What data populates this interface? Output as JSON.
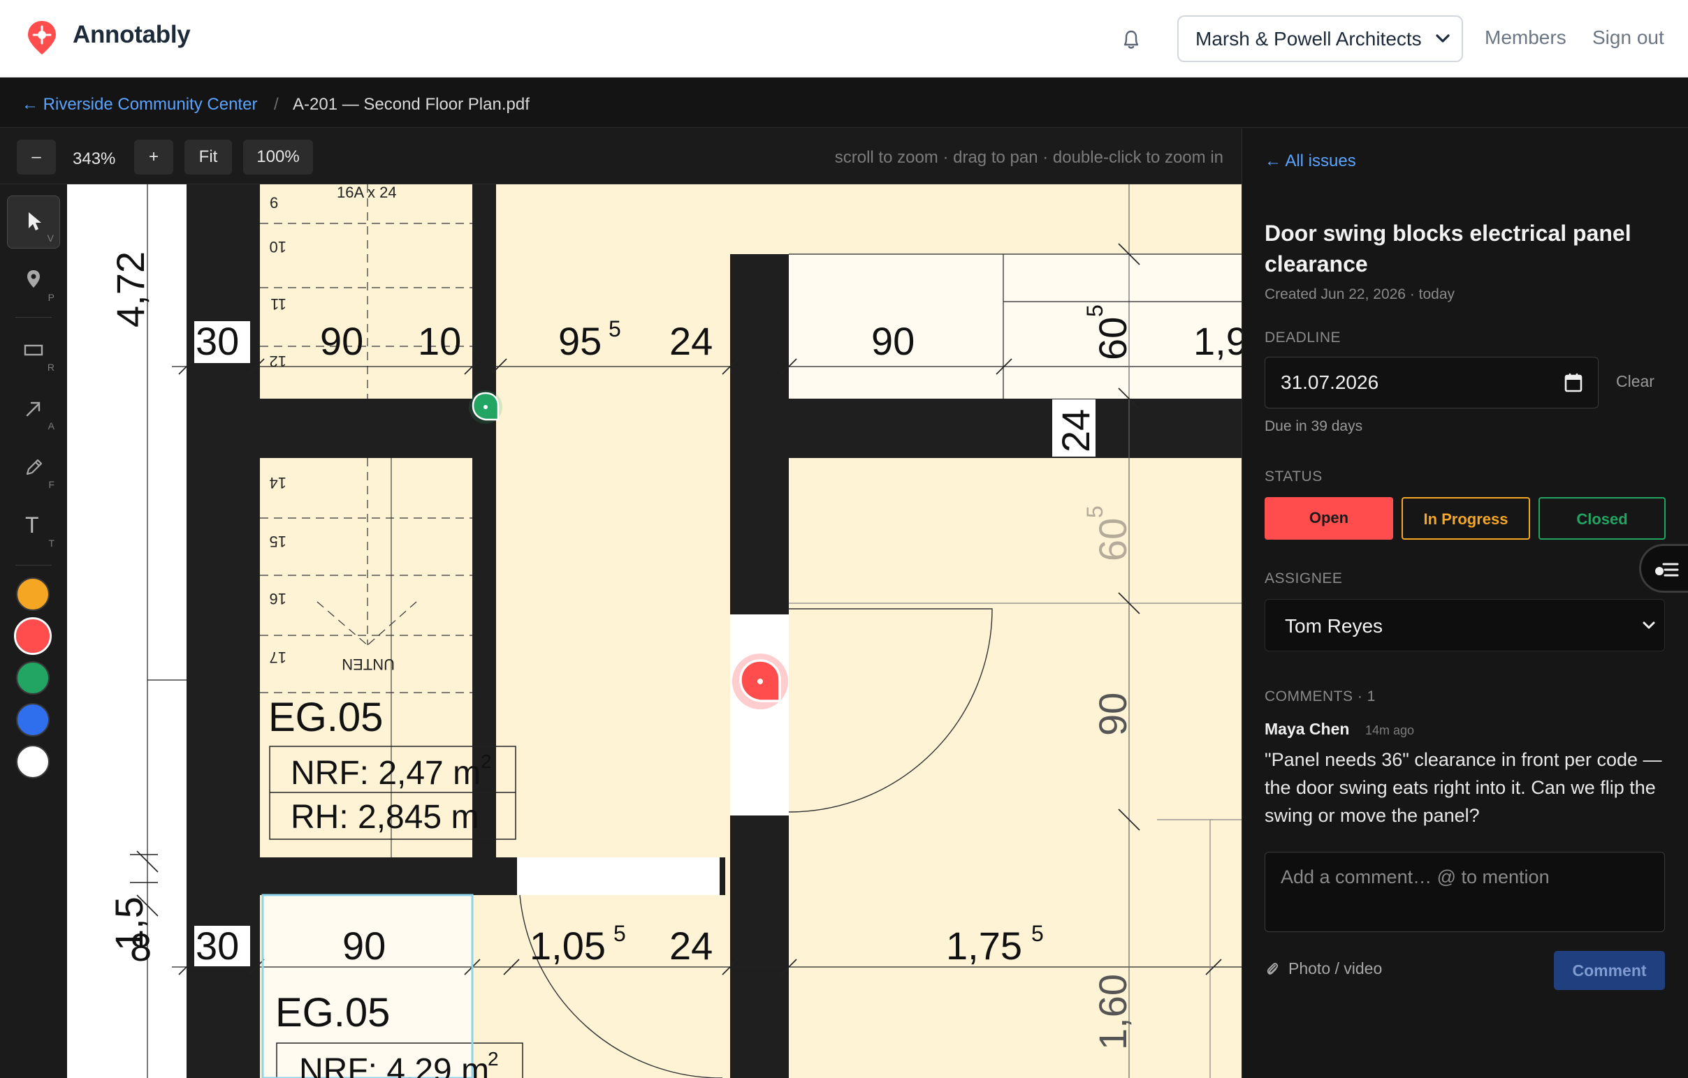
{
  "app": {
    "name": "Annotably",
    "brand_color": "#ff4d4d"
  },
  "header": {
    "org": "Marsh & Powell Architects",
    "members": "Members",
    "sign_out": "Sign out"
  },
  "breadcrumb": {
    "back": "← Riverside Community Center",
    "sep": "/",
    "file": "A-201 — Second Floor Plan.pdf"
  },
  "zoom": {
    "minus": "–",
    "value": "343%",
    "plus": "+",
    "fit": "Fit",
    "full": "100%",
    "hint": "scroll to zoom · drag to pan · double-click to zoom in"
  },
  "tools": [
    {
      "name": "select",
      "key": "V"
    },
    {
      "name": "pin",
      "key": "P"
    },
    {
      "name": "rectangle",
      "key": "R"
    },
    {
      "name": "arrow",
      "key": "A"
    },
    {
      "name": "freehand",
      "key": "F"
    },
    {
      "name": "text",
      "key": "T",
      "glyph": "T"
    }
  ],
  "colors": [
    "#f5a623",
    "#ff4d4d",
    "#22a463",
    "#2f6fed",
    "#ffffff"
  ],
  "selected_color": "#ff4d4d",
  "plan": {
    "dims": [
      "4,72",
      "30",
      "90",
      "10",
      "95",
      "5",
      "24",
      "90",
      "60",
      "5",
      "1,9",
      "24",
      "60",
      "5",
      "90",
      "1,5",
      "8",
      "30",
      "90",
      "1,05",
      "5",
      "24",
      "1,75",
      "5",
      "1,60"
    ],
    "stair_labels": [
      "16A x 24",
      "6",
      "10",
      "11",
      "12",
      "14",
      "15",
      "16",
      "17",
      "UNTEN"
    ],
    "room1": {
      "name": "EG.05",
      "nrf": "NRF: 2,47 m",
      "sup": "2",
      "rh": "RH: 2,845 m"
    },
    "room2": {
      "name": "EG.05",
      "nrf": "NRF: 4,29 m",
      "sup": "2"
    }
  },
  "issue": {
    "back": "← All issues",
    "title": "Door swing blocks electrical panel clearance",
    "created": "Created Jun 22, 2026 · today",
    "deadline_label": "DEADLINE",
    "deadline": "31.07.2026",
    "clear": "Clear",
    "due": "Due in 39 days",
    "status_label": "STATUS",
    "statuses": [
      "Open",
      "In Progress",
      "Closed"
    ],
    "status_colors": [
      "#ff4d4d",
      "#f5a623",
      "#22a463"
    ],
    "assignee_label": "ASSIGNEE",
    "assignee": "Tom Reyes",
    "comments_label": "COMMENTS · 1",
    "comment": {
      "author": "Maya Chen",
      "time": "14m ago",
      "text": "\"Panel needs 36\" clearance in front per code — the door swing eats right into it. Can we flip the swing or move the panel?"
    },
    "comment_placeholder": "Add a comment… @ to mention",
    "attach": "Photo / video",
    "send": "Comment"
  }
}
